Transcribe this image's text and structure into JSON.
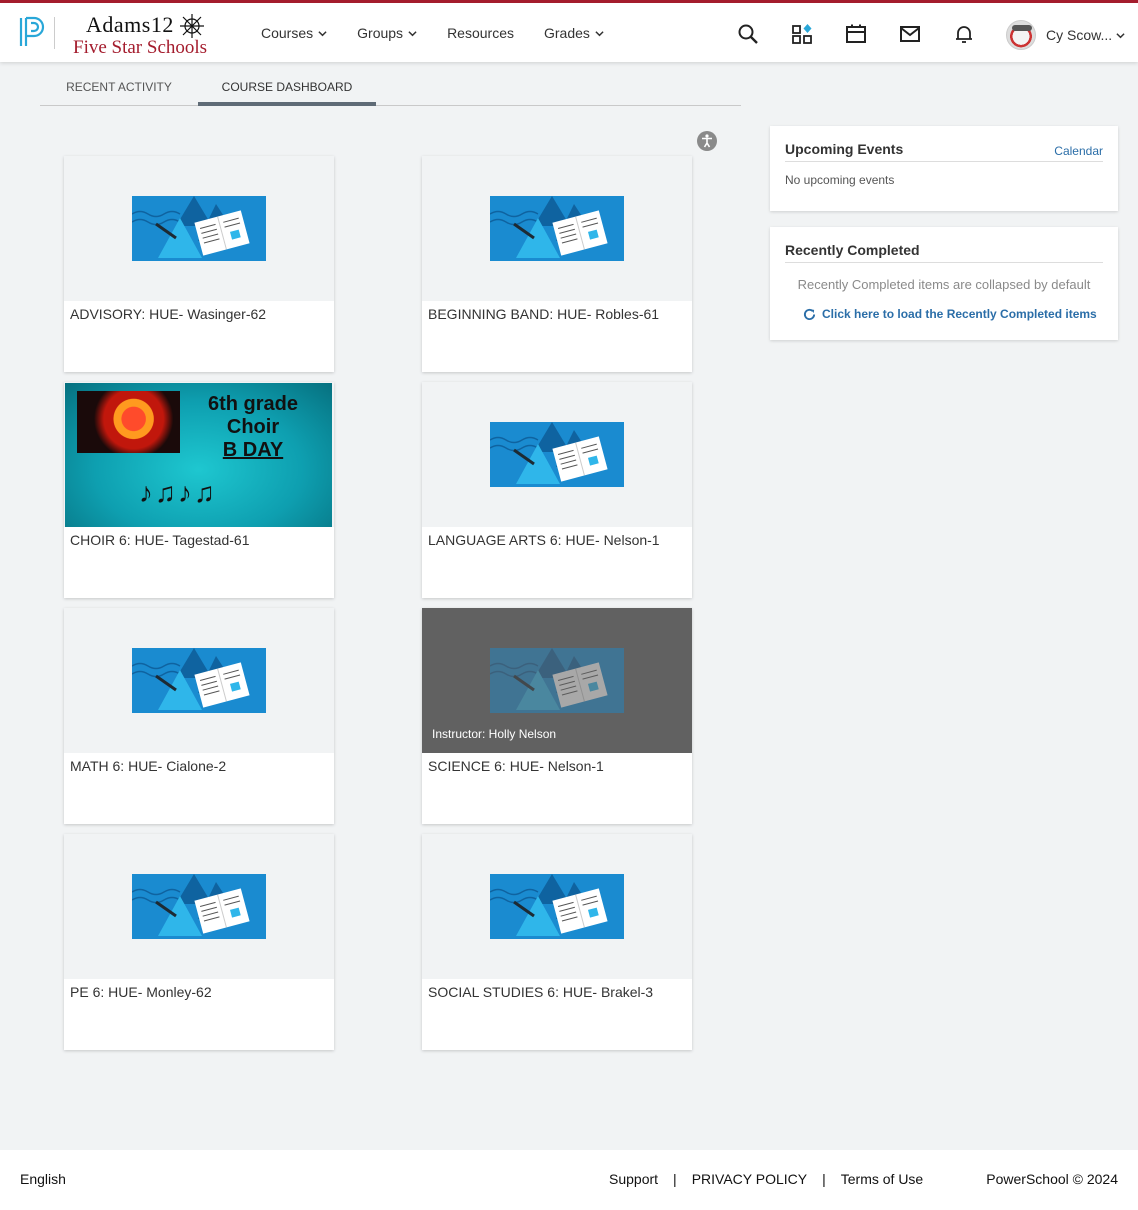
{
  "header": {
    "school_line1": "Adams12",
    "school_line2": "Five Star Schools",
    "nav": [
      {
        "label": "Courses",
        "dropdown": true
      },
      {
        "label": "Groups",
        "dropdown": true
      },
      {
        "label": "Resources",
        "dropdown": false
      },
      {
        "label": "Grades",
        "dropdown": true
      }
    ],
    "icons": [
      "search-icon",
      "apps-grid-icon",
      "calendar-icon",
      "mail-icon",
      "bell-icon"
    ],
    "user_name": "Cy Scow...",
    "accent_color": "#a41c2d"
  },
  "tabs": {
    "recent_activity": "RECENT ACTIVITY",
    "course_dashboard": "COURSE DASHBOARD",
    "active": "course_dashboard"
  },
  "courses": [
    {
      "title": "ADVISORY: HUE- Wasinger-62",
      "image": "default"
    },
    {
      "title": "BEGINNING BAND: HUE- Robles-61",
      "image": "default"
    },
    {
      "title": "CHOIR 6: HUE- Tagestad-61",
      "image": "choir"
    },
    {
      "title": "LANGUAGE ARTS 6: HUE- Nelson-1",
      "image": "default"
    },
    {
      "title": "MATH 6: HUE- Cialone-2",
      "image": "default"
    },
    {
      "title": "SCIENCE 6: HUE- Nelson-1",
      "image": "default",
      "hover": true
    },
    {
      "title": "PE 6: HUE- Monley-62",
      "image": "default"
    },
    {
      "title": "SOCIAL STUDIES 6: HUE- Brakel-3",
      "image": "default"
    }
  ],
  "hover_overlay": {
    "instructor": "Instructor: Holly Nelson"
  },
  "choir_image": {
    "line1": "6th grade",
    "line2": "Choir",
    "line3": "B DAY",
    "notes": "♪♫♪♫"
  },
  "upcoming": {
    "title": "Upcoming Events",
    "calendar_link": "Calendar",
    "empty_text": "No upcoming events"
  },
  "recently_completed": {
    "title": "Recently Completed",
    "info": "Recently Completed items are collapsed by default",
    "load_link": "Click here to load the Recently Completed items"
  },
  "footer": {
    "language": "English",
    "support": "Support",
    "privacy": "PRIVACY POLICY",
    "terms": "Terms of Use",
    "copyright": "PowerSchool © 2024",
    "separator": "|"
  }
}
